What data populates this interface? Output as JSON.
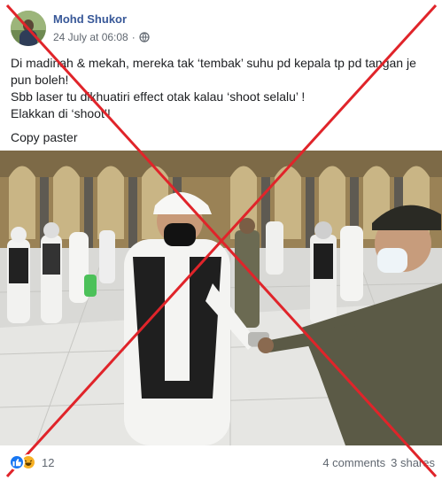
{
  "post": {
    "author": "Mohd Shukor",
    "timestamp": "24 July at 06:08",
    "separator": "·",
    "audience_icon": "globe-icon",
    "text_lines": [
      "Di madinah & mekah, mereka tak ‘tembak’ suhu pd kepala tp pd tangan je",
      "pun boleh!",
      "Sbb laser tu dikhuatiri effect otak kalau ‘shoot selalu’ !",
      "Elakkan di ‘shoot’!",
      "Copy paster"
    ]
  },
  "footer": {
    "reaction_icons": [
      "like-icon",
      "haha-icon"
    ],
    "reaction_count": "12",
    "comments": "4 comments",
    "shares": "3 shares"
  },
  "colors": {
    "author": "#385898",
    "meta": "#606770",
    "cross": "#e0242a",
    "like": "#1877f2",
    "haha": "#f7b125"
  }
}
